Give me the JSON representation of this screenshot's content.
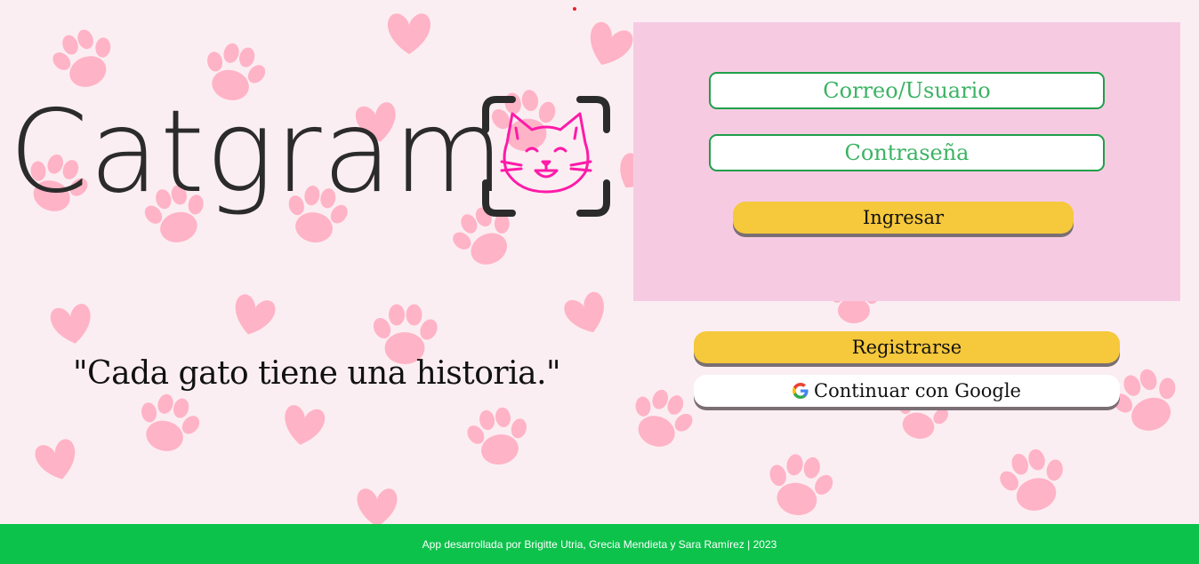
{
  "app": {
    "logo_text": "Catgram",
    "slogan": "\"Cada gato tiene una historia.\""
  },
  "login": {
    "user_placeholder": "Correo/Usuario",
    "password_placeholder": "Contraseña",
    "submit_label": "Ingresar"
  },
  "actions": {
    "register_label": "Registrarse",
    "google_label": "Continuar con Google"
  },
  "footer": {
    "credits": "App desarrollada por Brigitte Utria, Grecia Mendieta y Sara Ramírez | 2023"
  },
  "colors": {
    "background": "#fbeef3",
    "panel": "#f6cbe2",
    "accent_green": "#0cc24b",
    "button_yellow": "#f6c83b",
    "paw_pink": "#ffb3c6",
    "cat_icon": "#ff1aa8"
  }
}
